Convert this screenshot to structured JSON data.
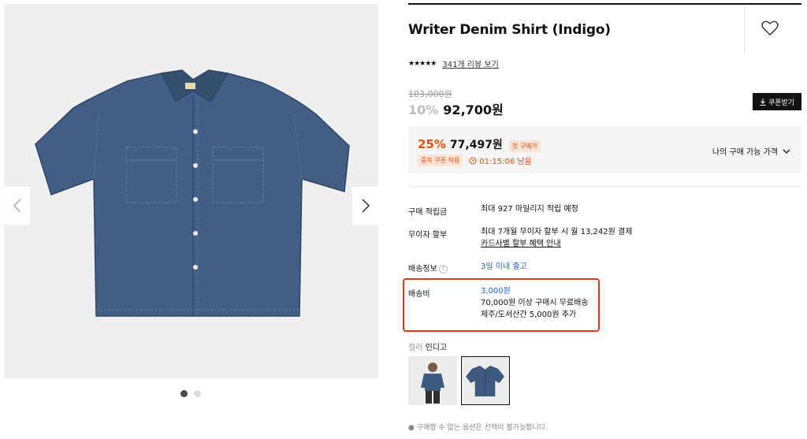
{
  "product": {
    "title": "Writer Denim Shirt (Indigo)",
    "stars": "★★★★★",
    "review_link": "341개 리뷰 보기",
    "original_price": "103,000원",
    "discount": "10%",
    "price": "92,700원",
    "coupon_button": "쿠폰받기"
  },
  "promo": {
    "percent": "25%",
    "price": "77,497원",
    "first_purchase_badge": "첫 구매가",
    "coupon_badge": "중복 쿠폰 적용",
    "timer": "01:15:06 남음",
    "available_price_label": "나의 구매 가능 가격"
  },
  "details": {
    "points_label": "구매 적립금",
    "points_value": "최대 927 마일리지 적립 예정",
    "installment_label": "무이자 할부",
    "installment_value": "최대 7개월 무이자 할부 시 월 13,242원 결제",
    "installment_link": "카드사별 할부 혜택 안내",
    "shipping_label": "배송정보",
    "shipping_value": "3일 이내 출고",
    "fee_label": "배송비",
    "fee_value": "3,000원",
    "fee_free": "70,000원 이상 구매시 무료배송",
    "fee_extra": "제주/도서산간 5,000원 추가"
  },
  "options": {
    "color_label": "컬러",
    "color_value": "인디고",
    "note": "● 구매할 수 없는 옵션은 선택이 불가능합니다."
  },
  "gallery": {
    "slide_count": 2,
    "active_slide": 1
  },
  "colors": {
    "accent": "#e84d0e",
    "link": "#1b63d6",
    "highlight": "#e03b1f",
    "denim": "#3f5a80"
  }
}
